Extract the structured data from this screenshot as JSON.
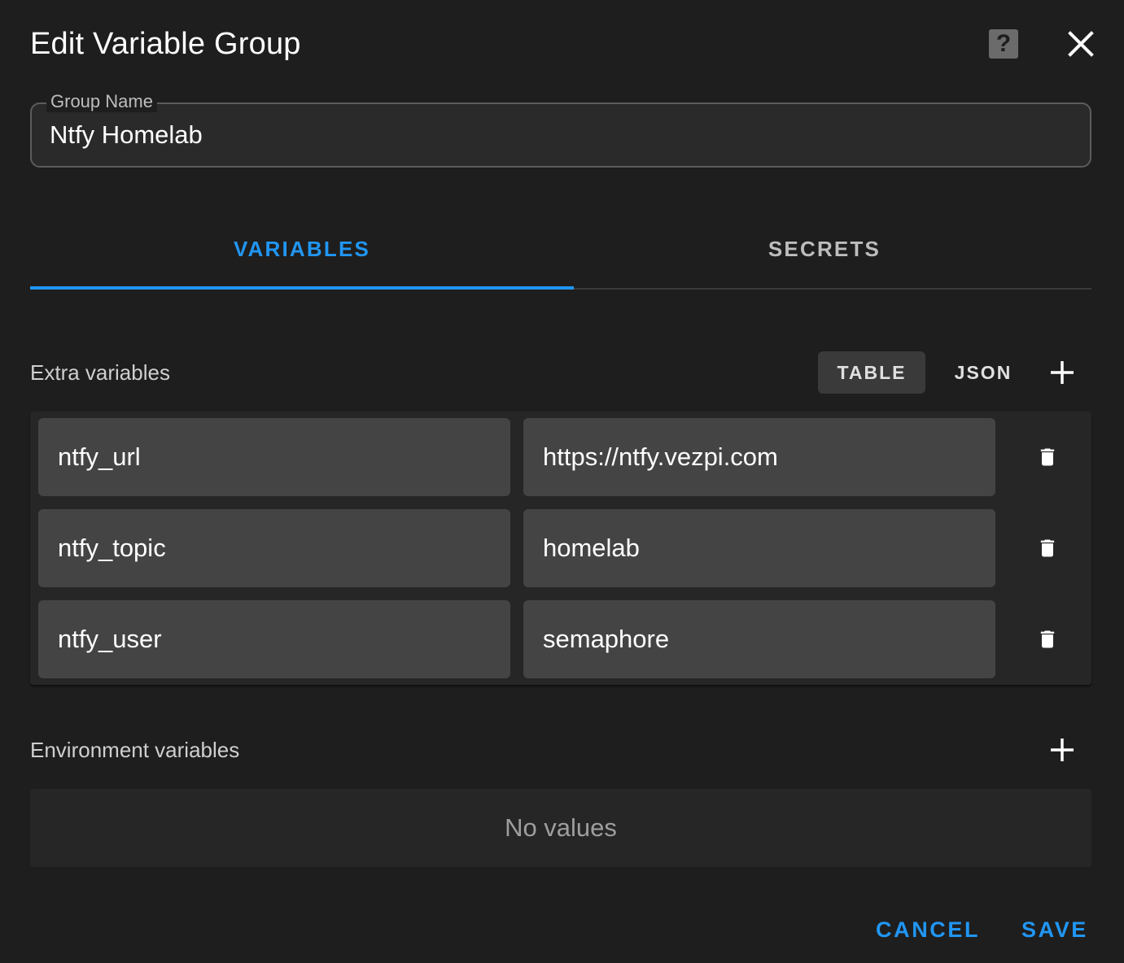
{
  "dialog": {
    "title": "Edit Variable Group",
    "help_label": "?"
  },
  "group_name": {
    "label": "Group Name",
    "value": "Ntfy Homelab"
  },
  "tabs": [
    {
      "label": "VARIABLES",
      "active": true
    },
    {
      "label": "SECRETS",
      "active": false
    }
  ],
  "extra_variables": {
    "label": "Extra variables",
    "view_toggle": {
      "table_label": "TABLE",
      "json_label": "JSON",
      "selected": "TABLE"
    },
    "rows": [
      {
        "key": "ntfy_url",
        "value": "https://ntfy.vezpi.com"
      },
      {
        "key": "ntfy_topic",
        "value": "homelab"
      },
      {
        "key": "ntfy_user",
        "value": "semaphore"
      }
    ]
  },
  "environment_variables": {
    "label": "Environment variables",
    "empty_text": "No values"
  },
  "actions": {
    "cancel_label": "CANCEL",
    "save_label": "SAVE"
  },
  "colors": {
    "accent": "#2196f3",
    "background": "#1e1e1e",
    "cell": "#444444"
  },
  "icons": {
    "help": "help-icon",
    "close": "close-icon",
    "add": "plus-icon",
    "delete": "trash-icon"
  }
}
